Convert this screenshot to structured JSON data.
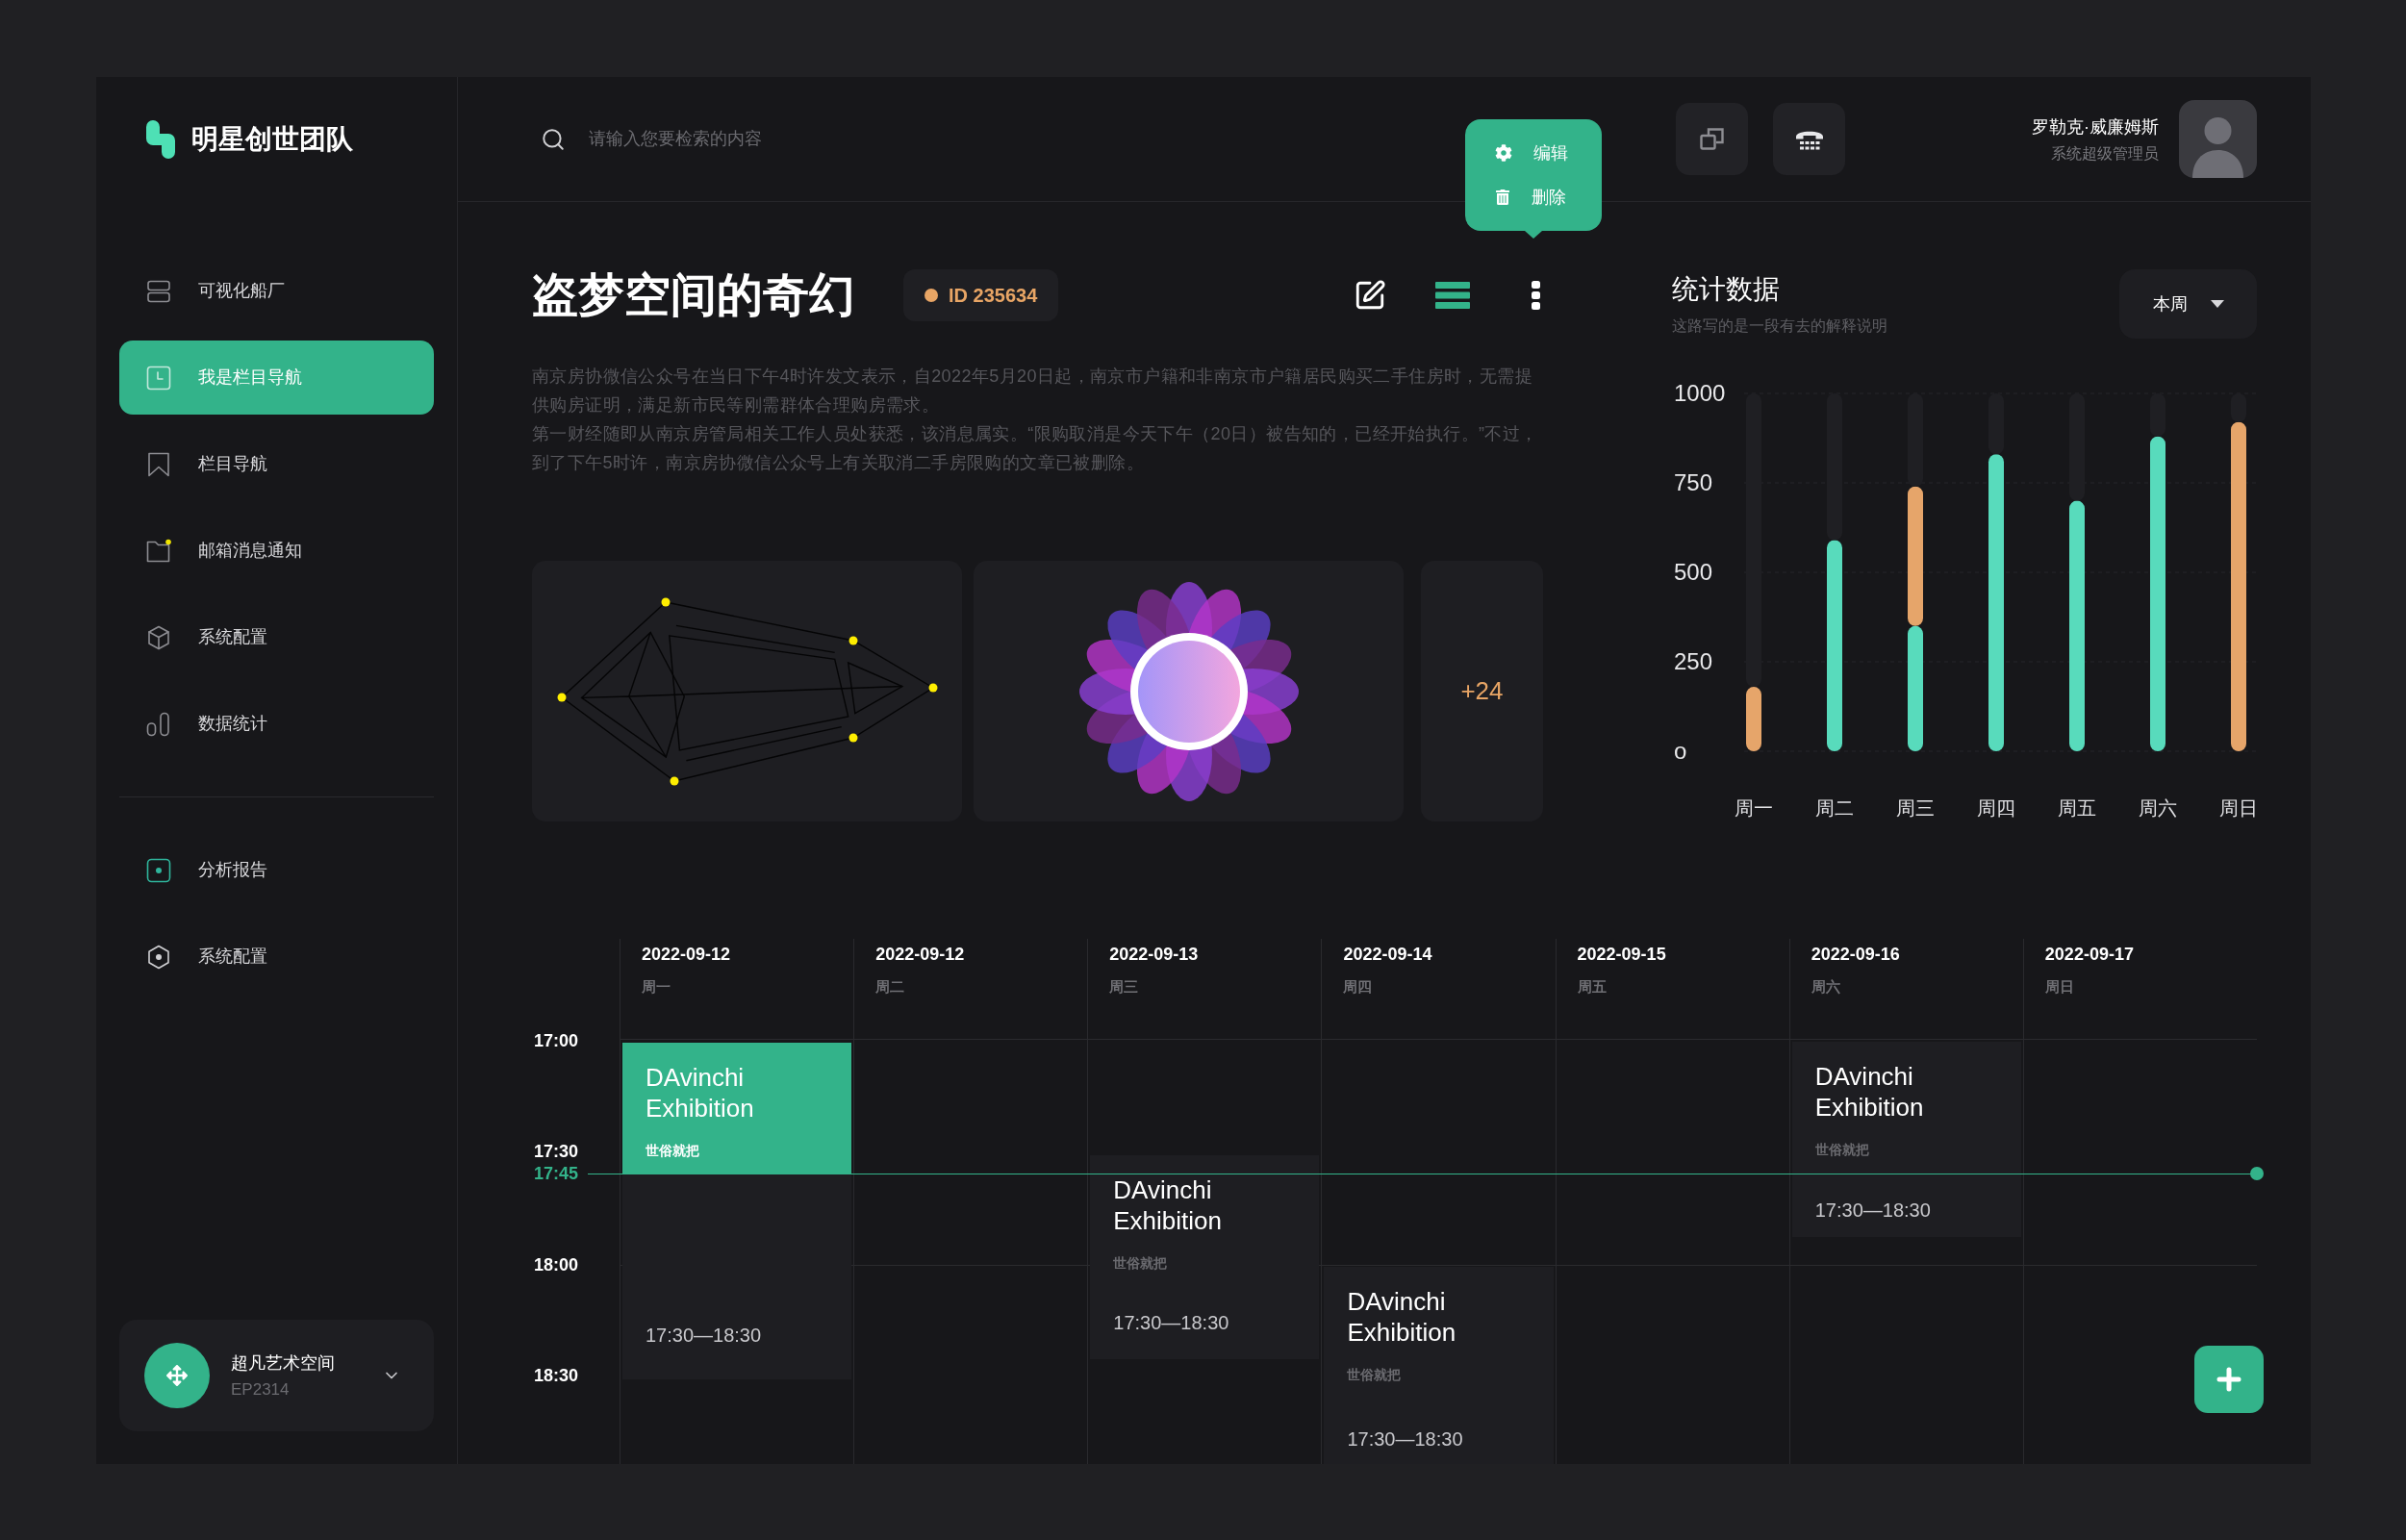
{
  "sidebar": {
    "logo": "明星创世团队",
    "nav": [
      {
        "label": "可视化船厂",
        "selected": false,
        "notify": false
      },
      {
        "label": "我是栏目导航",
        "selected": true,
        "notify": false
      },
      {
        "label": "栏目导航",
        "selected": false,
        "notify": false
      },
      {
        "label": "邮箱消息通知",
        "selected": false,
        "notify": true
      },
      {
        "label": "系统配置",
        "selected": false,
        "notify": false
      },
      {
        "label": "数据统计",
        "selected": false,
        "notify": false
      }
    ],
    "nav_secondary": [
      {
        "label": "分析报告",
        "selected": false
      },
      {
        "label": "系统配置",
        "selected": false
      }
    ],
    "workspace": {
      "name": "超凡艺术空间",
      "code": "EP2314"
    }
  },
  "header": {
    "search": {
      "placeholder": "请输入您要检索的内容"
    },
    "popover_menu": [
      {
        "label": "编辑"
      },
      {
        "label": "删除"
      }
    ],
    "user": {
      "name": "罗勒克·威廉姆斯",
      "role": "系统超级管理员"
    }
  },
  "article": {
    "title": "盗梦空间的奇幻",
    "id_badge": "ID 235634",
    "actions": [
      {
        "selected": false
      },
      {
        "selected": true
      },
      {
        "selected": false
      }
    ],
    "paragraphs": [
      "南京房协微信公众号在当日下午4时许发文表示，自2022年5月20日起，南京市户籍和非南京市户籍居民购买二手住房时，无需提供购房证明，满足新市民等刚需群体合理购房需求。",
      "第一财经随即从南京房管局相关工作人员处获悉，该消息属实。“限购取消是今天下午（20日）被告知的，已经开始执行。”不过，到了下午5时许，南京房协微信公众号上有关取消二手房限购的文章已被删除。"
    ],
    "gallery": {
      "more_count": "+24"
    }
  },
  "stats": {
    "title": "统计数据",
    "subtitle": "这路写的是一段有去的解释说明",
    "period": "本周",
    "chart_data": {
      "type": "bar",
      "categories": [
        "周一",
        "周二",
        "周三",
        "周四",
        "周五",
        "周六",
        "周日"
      ],
      "series": [
        {
          "color": "#58dbbc",
          "values": [
            null,
            590,
            350,
            830,
            700,
            880,
            null
          ]
        },
        {
          "color": "#e6a56a",
          "values": [
            180,
            null,
            390,
            null,
            null,
            null,
            920
          ]
        },
        {
          "color": "#1f1f23",
          "values": [
            820,
            410,
            260,
            170,
            300,
            120,
            80
          ]
        }
      ],
      "stacked": true,
      "grid": true,
      "ylim": [
        0,
        1000
      ],
      "yticks": [
        {
          "value": 0,
          "label": "o"
        },
        250,
        500,
        750,
        1000
      ]
    }
  },
  "calendar": {
    "times": [
      "17:00",
      "17:30",
      "18:00",
      "18:30"
    ],
    "now": "17:45",
    "days": [
      {
        "date": "2022-09-12",
        "weekday": "周一",
        "events": [
          {
            "title": "DAvinchi Exhibition",
            "subtitle": "世俗就把",
            "time": "17:30—18:30",
            "selected": true
          }
        ]
      },
      {
        "date": "2022-09-12",
        "weekday": "周二"
      },
      {
        "date": "2022-09-13",
        "weekday": "周三",
        "events": [
          {
            "title": "DAvinchi Exhibition",
            "subtitle": "世俗就把",
            "time": "17:30—18:30",
            "selected": false
          }
        ]
      },
      {
        "date": "2022-09-14",
        "weekday": "周四",
        "events": [
          {
            "title": "DAvinchi Exhibition",
            "subtitle": "世俗就把",
            "time": "17:30—18:30",
            "selected": false
          }
        ]
      },
      {
        "date": "2022-09-15",
        "weekday": "周五"
      },
      {
        "date": "2022-09-16",
        "weekday": "周六",
        "events": [
          {
            "title": "DAvinchi Exhibition",
            "subtitle": "世俗就把",
            "time": "17:30—18:30",
            "selected": false
          }
        ]
      },
      {
        "date": "2022-09-17",
        "weekday": "周日"
      }
    ]
  }
}
